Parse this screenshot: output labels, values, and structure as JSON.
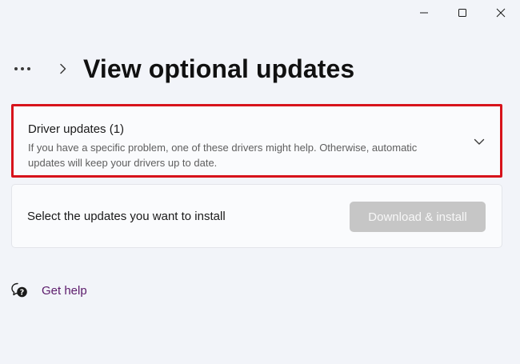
{
  "window": {
    "controls": {
      "minimize_icon": "minimize-icon",
      "maximize_icon": "maximize-icon",
      "close_icon": "close-icon"
    }
  },
  "breadcrumb": {
    "more_icon": "more-dots-icon",
    "separator_icon": "chevron-right-icon"
  },
  "page": {
    "title": "View optional updates"
  },
  "driver_updates": {
    "title": "Driver updates (1)",
    "description": "If you have a specific problem, one of these drivers might help. Otherwise, automatic updates will keep your drivers up to date.",
    "expand_icon": "chevron-down-icon",
    "highlight_color": "#d7131b"
  },
  "install_section": {
    "label": "Select the updates you want to install",
    "button_label": "Download & install",
    "button_enabled": false
  },
  "help": {
    "label": "Get help",
    "icon": "help-chat-icon",
    "link_color": "#5b1a6b"
  }
}
